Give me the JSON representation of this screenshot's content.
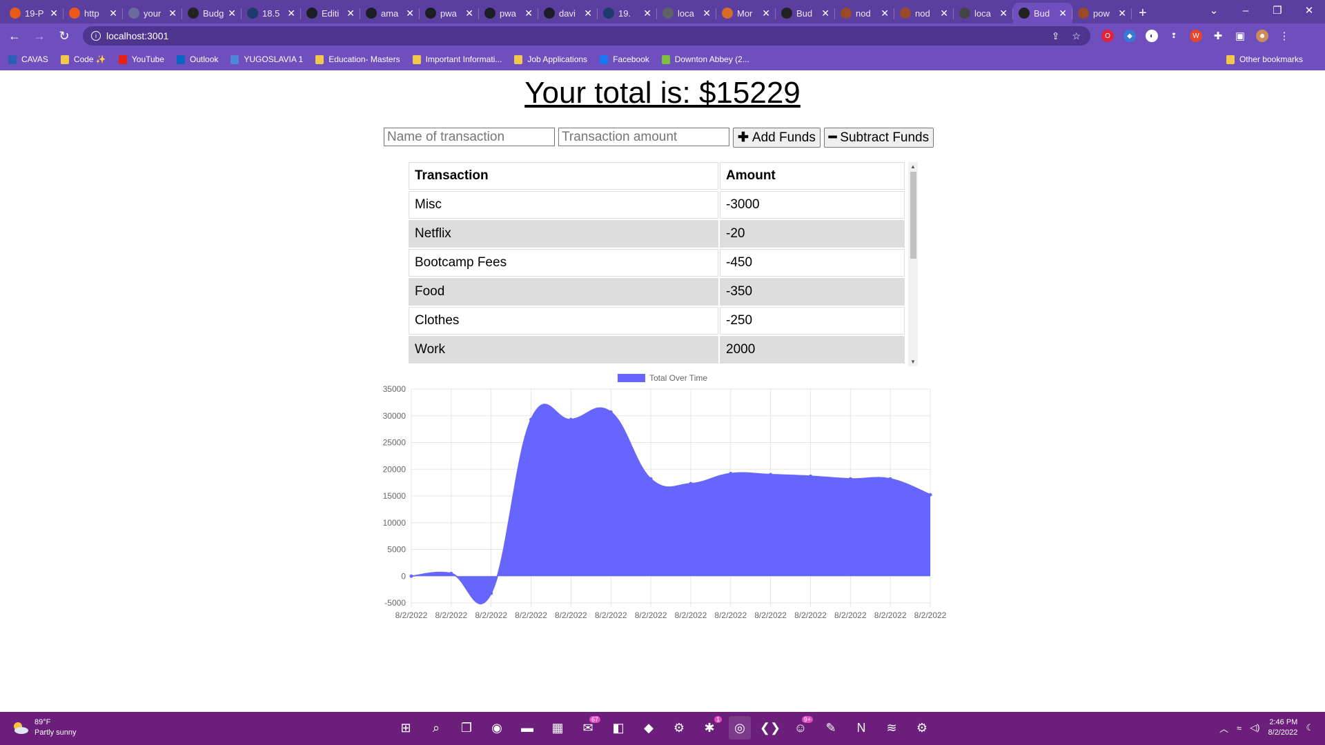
{
  "browser": {
    "tabs": [
      {
        "title": "19-P",
        "color": "#e8591a"
      },
      {
        "title": "http",
        "color": "#e8591a"
      },
      {
        "title": "your",
        "color": "#6b6b9e"
      },
      {
        "title": "Budg",
        "color": "#222222"
      },
      {
        "title": "18.5",
        "color": "#1e3a6e"
      },
      {
        "title": "Editi",
        "color": "#1b1f23"
      },
      {
        "title": "ama",
        "color": "#1b1f23"
      },
      {
        "title": "pwa",
        "color": "#1b1f23"
      },
      {
        "title": "pwa",
        "color": "#1b1f23"
      },
      {
        "title": "davi",
        "color": "#1b1f23"
      },
      {
        "title": "19.",
        "color": "#1e3a6e"
      },
      {
        "title": "loca",
        "color": "#5f6368"
      },
      {
        "title": "Mor",
        "color": "#d86b2a"
      },
      {
        "title": "Bud",
        "color": "#222222"
      },
      {
        "title": "nod",
        "color": "#9a4a2a"
      },
      {
        "title": "nod",
        "color": "#9a4a2a"
      },
      {
        "title": "loca",
        "color": "#444444"
      },
      {
        "title": "Bud",
        "color": "#222222",
        "active": true
      },
      {
        "title": "pow",
        "color": "#9a4a2a"
      }
    ],
    "url": "localhost:3001",
    "bookmarks": [
      {
        "label": "CAVAS",
        "color": "#2b5fb4"
      },
      {
        "label": "Code ✨",
        "color": "#f2c84b"
      },
      {
        "label": "YouTube",
        "color": "#e62117"
      },
      {
        "label": "Outlook",
        "color": "#0a64c6"
      },
      {
        "label": "YUGOSLAVIA 1",
        "color": "#4e87d8"
      },
      {
        "label": "Education- Masters",
        "color": "#f2c84b"
      },
      {
        "label": "Important Informati...",
        "color": "#f2c84b"
      },
      {
        "label": "Job Applications",
        "color": "#f2c84b"
      },
      {
        "label": "Facebook",
        "color": "#1877f2"
      },
      {
        "label": "Downton Abbey (2...",
        "color": "#7fbf3f"
      }
    ],
    "other_bookmarks": "Other bookmarks"
  },
  "page": {
    "total_label": "Your total is: $15229",
    "name_placeholder": "Name of transaction",
    "amount_placeholder": "Transaction amount",
    "add_label": "Add Funds",
    "subtract_label": "Subtract Funds",
    "table": {
      "headers": [
        "Transaction",
        "Amount"
      ],
      "rows": [
        [
          "Misc",
          "-3000"
        ],
        [
          "Netflix",
          "-20"
        ],
        [
          "Bootcamp Fees",
          "-450"
        ],
        [
          "Food",
          "-350"
        ],
        [
          "Clothes",
          "-250"
        ],
        [
          "Work",
          "2000"
        ]
      ]
    }
  },
  "chart_data": {
    "type": "area",
    "legend": "Total Over Time",
    "legend_position": "top",
    "color": "#6666ff",
    "x": [
      "8/2/2022",
      "8/2/2022",
      "8/2/2022",
      "8/2/2022",
      "8/2/2022",
      "8/2/2022",
      "8/2/2022",
      "8/2/2022",
      "8/2/2022",
      "8/2/2022",
      "8/2/2022",
      "8/2/2022",
      "8/2/2022",
      "8/2/2022"
    ],
    "values": [
      0,
      500,
      -3200,
      29300,
      29300,
      30700,
      18200,
      17300,
      19200,
      19000,
      18700,
      18200,
      18200,
      15229
    ],
    "yticks": [
      35000,
      30000,
      25000,
      20000,
      15000,
      10000,
      5000,
      0,
      -5000
    ],
    "ylim": [
      -5000,
      35000
    ],
    "grid": true
  },
  "taskbar": {
    "weather_temp": "89°F",
    "weather_desc": "Partly sunny",
    "time": "2:46 PM",
    "date": "8/2/2022",
    "apps": [
      {
        "name": "start-button",
        "glyph": "⊞",
        "active": false
      },
      {
        "name": "search-taskbar-icon",
        "glyph": "⌕",
        "active": false
      },
      {
        "name": "task-view-icon",
        "glyph": "❐",
        "active": false
      },
      {
        "name": "teams-icon",
        "glyph": "◉",
        "active": false
      },
      {
        "name": "file-explorer-icon",
        "glyph": "▬",
        "active": false
      },
      {
        "name": "store-icon",
        "glyph": "▦",
        "active": false
      },
      {
        "name": "mail-icon",
        "glyph": "✉",
        "badge": "67",
        "active": false
      },
      {
        "name": "office-icon",
        "glyph": "◧",
        "active": false
      },
      {
        "name": "unity-icon",
        "glyph": "◆",
        "active": false
      },
      {
        "name": "steam-icon",
        "glyph": "⚙",
        "active": false
      },
      {
        "name": "slack-icon",
        "glyph": "✱",
        "badge": "1",
        "active": false
      },
      {
        "name": "chrome-icon",
        "glyph": "◎",
        "active": true
      },
      {
        "name": "vscode-icon",
        "glyph": "❮❯",
        "active": false
      },
      {
        "name": "discord-icon",
        "glyph": "☺",
        "badge": "9+",
        "active": false
      },
      {
        "name": "paint-app-icon",
        "glyph": "✎",
        "active": false
      },
      {
        "name": "netflix-icon",
        "glyph": "N",
        "active": false
      },
      {
        "name": "spotify-icon",
        "glyph": "≋",
        "active": false
      },
      {
        "name": "settings-icon",
        "glyph": "⚙",
        "active": false
      }
    ]
  }
}
